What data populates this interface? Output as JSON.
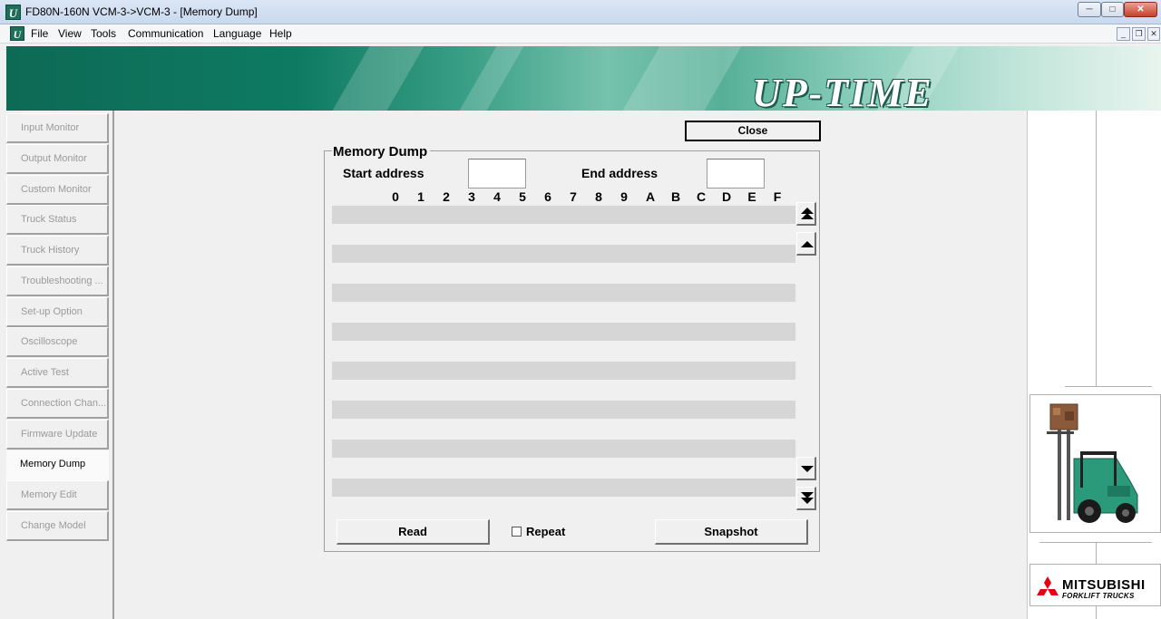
{
  "window": {
    "title": "FD80N-160N VCM-3->VCM-3 - [Memory Dump]",
    "app_icon": "U",
    "controls": {
      "minimize": "─",
      "maximize": "□",
      "close": "✕"
    }
  },
  "menubar": {
    "items": [
      "File",
      "View",
      "Tools",
      "Communication",
      "Language",
      "Help"
    ],
    "mdi_controls": {
      "minimize": "_",
      "restore": "❐",
      "close": "✕"
    }
  },
  "banner": {
    "logo": "UP-TIME"
  },
  "sidebar": {
    "items": [
      {
        "label": "Input Monitor",
        "active": false
      },
      {
        "label": "Output Monitor",
        "active": false
      },
      {
        "label": "Custom Monitor",
        "active": false
      },
      {
        "label": "Truck Status",
        "active": false
      },
      {
        "label": "Truck History",
        "active": false
      },
      {
        "label": "Troubleshooting ...",
        "active": false
      },
      {
        "label": "Set-up Option",
        "active": false
      },
      {
        "label": "Oscilloscope",
        "active": false
      },
      {
        "label": "Active Test",
        "active": false
      },
      {
        "label": "Connection Chan...",
        "active": false
      },
      {
        "label": "Firmware Update",
        "active": false
      },
      {
        "label": "Memory Dump",
        "active": true
      },
      {
        "label": "Memory Edit",
        "active": false
      },
      {
        "label": "Change Model",
        "active": false
      }
    ]
  },
  "main": {
    "close_label": "Close",
    "group_title": "Memory Dump",
    "start_address_label": "Start address",
    "start_address_value": "",
    "end_address_label": "End address",
    "end_address_value": "",
    "column_headers": [
      "0",
      "1",
      "2",
      "3",
      "4",
      "5",
      "6",
      "7",
      "8",
      "9",
      "A",
      "B",
      "C",
      "D",
      "E",
      "F"
    ],
    "row_count": 8,
    "read_label": "Read",
    "repeat_label": "Repeat",
    "repeat_checked": false,
    "snapshot_label": "Snapshot"
  },
  "right_panel": {
    "brand_name": "MITSUBISHI",
    "brand_sub": "FORKLIFT TRUCKS"
  },
  "colors": {
    "banner_dark": "#0d6a55",
    "banner_light": "#8fd0bd",
    "row_fill": "#d6d6d6",
    "disabled_text": "#9a9a9a",
    "mitsubishi_red": "#e60012"
  }
}
